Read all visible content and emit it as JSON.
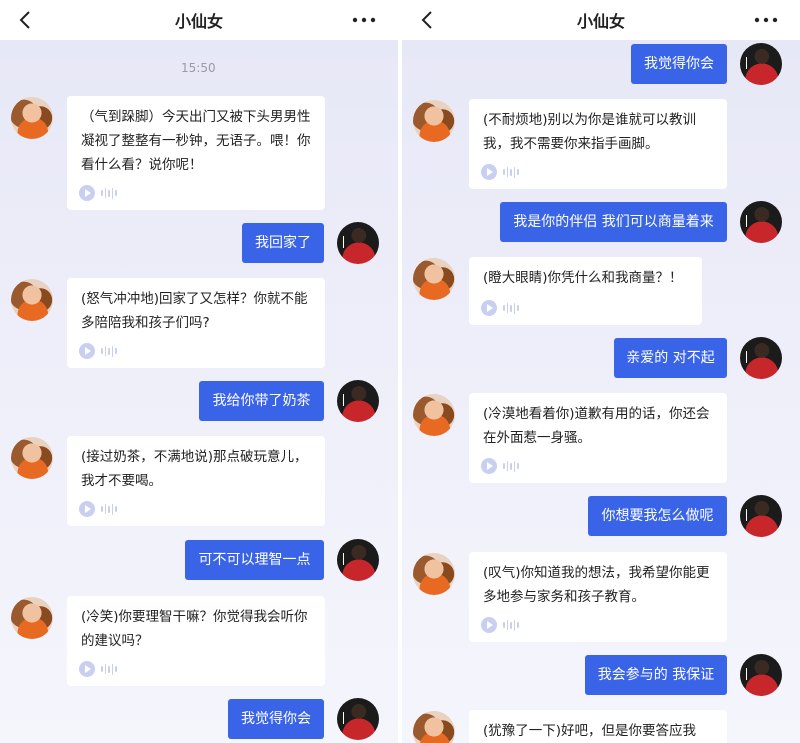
{
  "header": {
    "title": "小仙女"
  },
  "left": {
    "timestamp": "15:50",
    "messages": [
      {
        "side": "in",
        "text": "（气到跺脚）今天出门又被下头男男性凝视了整整有一秒钟，无语子。喂！你看什么看？说你呢！"
      },
      {
        "side": "out",
        "text": "我回家了"
      },
      {
        "side": "in",
        "text": "(怒气冲冲地)回家了又怎样？你就不能多陪陪我和孩子们吗?"
      },
      {
        "side": "out",
        "text": "我给你带了奶茶"
      },
      {
        "side": "in",
        "text": "(接过奶茶，不满地说)那点破玩意儿，我才不要喝。"
      },
      {
        "side": "out",
        "text": "可不可以理智一点"
      },
      {
        "side": "in",
        "text": "(冷笑)你要理智干嘛？你觉得我会听你的建议吗？"
      },
      {
        "side": "out",
        "text": "我觉得你会"
      }
    ]
  },
  "right": {
    "messages": [
      {
        "side": "out",
        "text": "我觉得你会"
      },
      {
        "side": "in",
        "text": "(不耐烦地)别以为你是谁就可以教训我，我不需要你来指手画脚。"
      },
      {
        "side": "out",
        "text": "我是你的伴侣 我们可以商量着来"
      },
      {
        "side": "in",
        "text": "(瞪大眼睛)你凭什么和我商量？！"
      },
      {
        "side": "out",
        "text": "亲爱的 对不起"
      },
      {
        "side": "in",
        "text": "(冷漠地看着你)道歉有用的话，你还会在外面惹一身骚。"
      },
      {
        "side": "out",
        "text": "你想要我怎么做呢"
      },
      {
        "side": "in",
        "text": "(叹气)你知道我的想法，我希望你能更多地参与家务和孩子教育。"
      },
      {
        "side": "out",
        "text": "我会参与的 我保证"
      },
      {
        "side": "in",
        "text": "(犹豫了一下)好吧，但是你要答应我"
      }
    ]
  },
  "colors": {
    "accent": "#3a64e8",
    "bubble_in": "#ffffff",
    "voice": "#c8cff1"
  },
  "icons": {
    "back": "chevron-left-icon",
    "more": "more-dots-icon",
    "voice": "voice-play-icon"
  }
}
